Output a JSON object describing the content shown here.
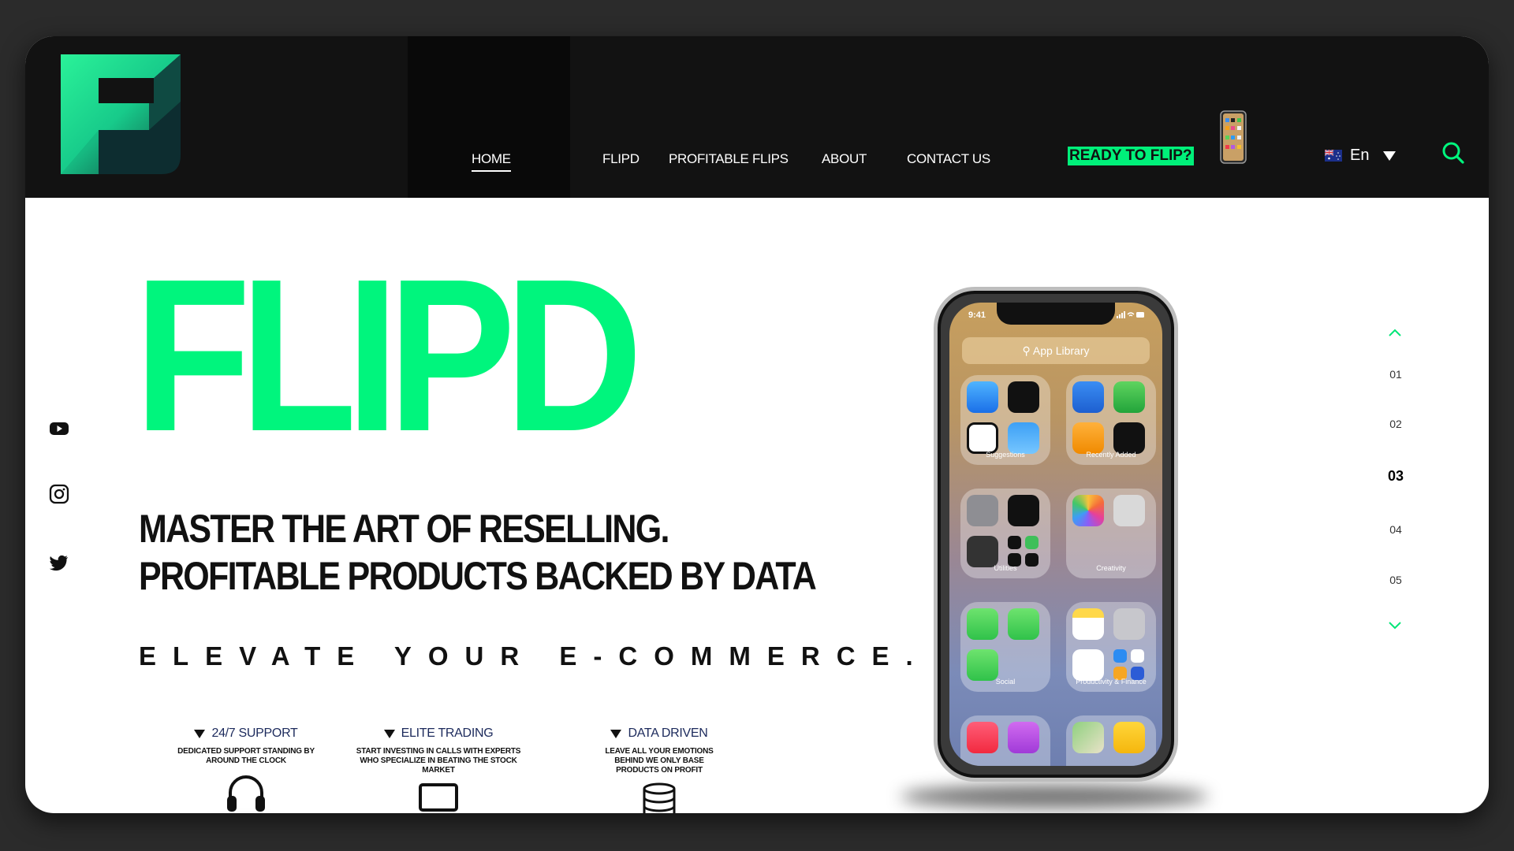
{
  "colors": {
    "brand_green": "#00f57d",
    "header_bg": "#121212",
    "feature_heading": "#1c2a5c"
  },
  "header": {
    "logo_icon": "flipd-f-logo",
    "nav": [
      {
        "label": "HOME",
        "active": true
      },
      {
        "label": "FLIPD"
      },
      {
        "label": "PROFITABLE FLIPS"
      },
      {
        "label": "ABOUT"
      },
      {
        "label": "CONTACT US"
      }
    ],
    "cta_label": "READY TO FLIP?",
    "language": {
      "flag_icon": "australia-flag-icon",
      "label": "En"
    },
    "search_icon": "search-icon"
  },
  "social": [
    "youtube-icon",
    "instagram-icon",
    "twitter-icon"
  ],
  "hero": {
    "title": "FLIPD",
    "tagline_1": "MASTER THE ART OF RESELLING.",
    "tagline_2": "PROFITABLE PRODUCTS BACKED BY DATA",
    "subtitle": "ELEVATE YOUR E-COMMERCE."
  },
  "features": [
    {
      "title": "24/7 SUPPORT",
      "description": "DEDICATED SUPPORT STANDING BY AROUND THE CLOCK",
      "icon": "headphones-icon"
    },
    {
      "title": "ELITE TRADING",
      "description": "START INVESTING IN CALLS WITH EXPERTS WHO SPECIALIZE IN BEATING THE STOCK MARKET",
      "icon": "laptop-icon"
    },
    {
      "title": "DATA DRIVEN",
      "description": "LEAVE ALL YOUR EMOTIONS BEHIND WE ONLY BASE PRODUCTS ON PROFIT",
      "icon": "database-icon"
    }
  ],
  "phone": {
    "time": "9:41",
    "search_placeholder": "App Library",
    "folders": [
      "Suggestions",
      "Recently Added",
      "Utilities",
      "Creativity",
      "Social",
      "Productivity & Finance"
    ]
  },
  "pager": {
    "pages": [
      "01",
      "02",
      "03",
      "04",
      "05"
    ],
    "active_index": 2
  }
}
